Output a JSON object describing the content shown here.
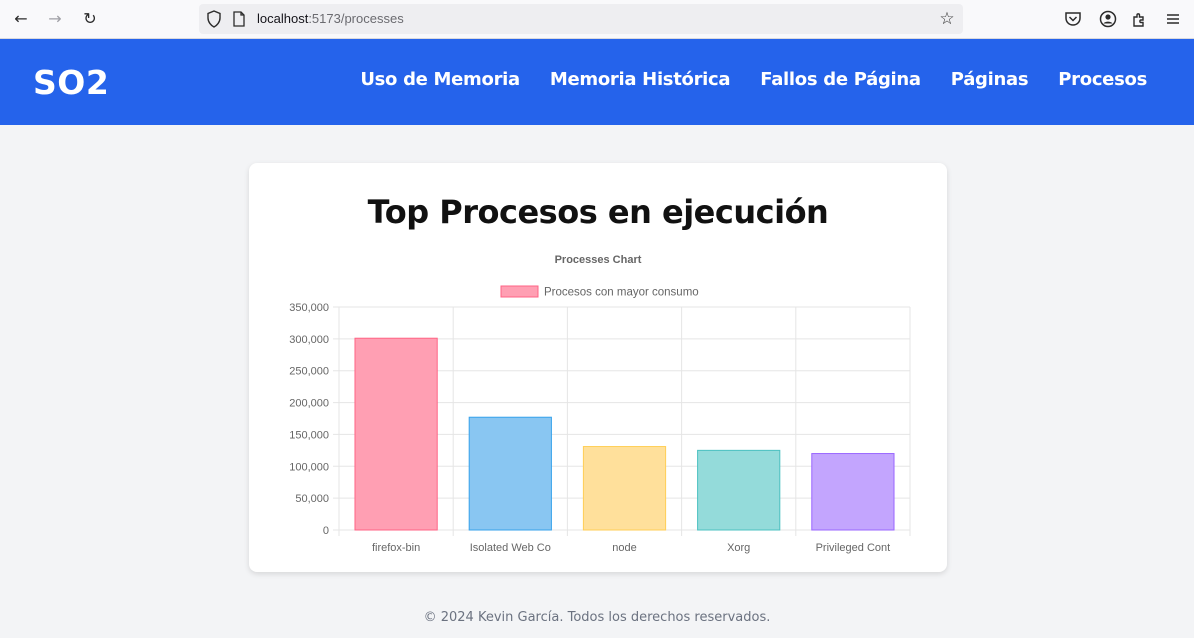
{
  "browser": {
    "url_host": "localhost",
    "url_path": ":5173/processes"
  },
  "header": {
    "brand": "SO2",
    "nav": [
      {
        "label": "Uso de Memoria"
      },
      {
        "label": "Memoria Histórica"
      },
      {
        "label": "Fallos de Página"
      },
      {
        "label": "Páginas"
      },
      {
        "label": "Procesos"
      }
    ]
  },
  "card": {
    "title": "Top Procesos en ejecución"
  },
  "chart_data": {
    "type": "bar",
    "title": "Processes Chart",
    "categories": [
      "firefox-bin",
      "Isolated Web Co",
      "node",
      "Xorg",
      "Privileged Cont"
    ],
    "series": [
      {
        "name": "Procesos con mayor consumo",
        "values": [
          301000,
          177000,
          131000,
          125000,
          120000
        ]
      }
    ],
    "bar_fill_colors": [
      "#ff9fb3",
      "#89c6f2",
      "#ffe09b",
      "#94dbda",
      "#c3a5fe"
    ],
    "bar_stroke_colors": [
      "#ff6384",
      "#36a2eb",
      "#ffce56",
      "#4bc0c0",
      "#9966ff"
    ],
    "legend_swatch": {
      "fill": "#ff9fb3",
      "stroke": "#ff6384"
    },
    "ylim": [
      0,
      350000
    ],
    "yticks": [
      0,
      50000,
      100000,
      150000,
      200000,
      250000,
      300000,
      350000
    ],
    "grid": true,
    "legend_position": "top"
  },
  "footer": {
    "text": "© 2024 Kevin García. Todos los derechos reservados."
  }
}
